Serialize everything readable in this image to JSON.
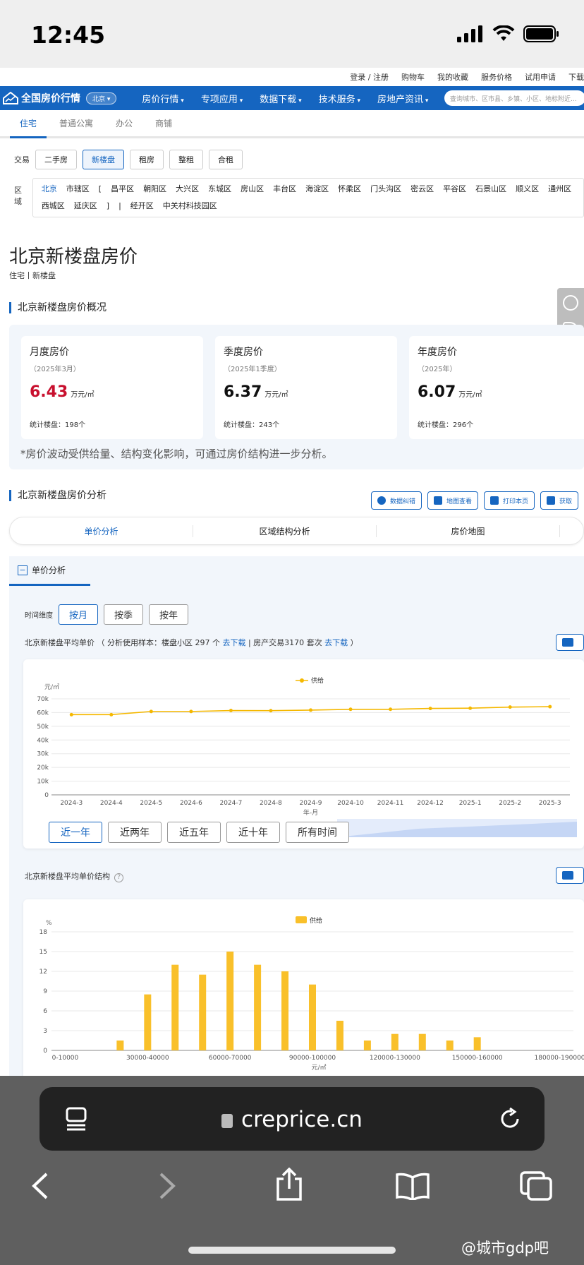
{
  "status_bar": {
    "time": "12:45"
  },
  "topbar": {
    "links": [
      "登录 / 注册",
      "购物车",
      "我的收藏",
      "服务价格",
      "试用申请",
      "下载"
    ]
  },
  "nav": {
    "logo": "全国房价行情",
    "city": "北京",
    "items": [
      "房价行情",
      "专项应用",
      "数据下载",
      "技术服务",
      "房地产资讯"
    ],
    "search_placeholder": "查询城市、区市县、乡镇、小区、地标附近..."
  },
  "property_tabs": [
    "住宅",
    "普通公寓",
    "办公",
    "商铺"
  ],
  "trade": {
    "label": "交易",
    "options": [
      "二手房",
      "新楼盘",
      "租房",
      "整租",
      "合租"
    ]
  },
  "district": {
    "label": "区域",
    "items": [
      "北京",
      "市辖区",
      "[",
      "昌平区",
      "朝阳区",
      "大兴区",
      "东城区",
      "房山区",
      "丰台区",
      "海淀区",
      "怀柔区",
      "门头沟区",
      "密云区",
      "平谷区",
      "石景山区",
      "顺义区",
      "通州区",
      "西城区",
      "延庆区",
      "]",
      "|",
      "经开区",
      "中关村科技园区"
    ]
  },
  "page_title": "北京新楼盘房价",
  "breadcrumb": "住宅丨新楼盘",
  "overview": {
    "heading": "北京新楼盘房价概况",
    "cards": [
      {
        "title": "月度房价",
        "period": "（2025年3月）",
        "value": "6.43",
        "unit": "万元/㎡",
        "count": "统计楼盘：198个"
      },
      {
        "title": "季度房价",
        "period": "（2025年1季度）",
        "value": "6.37",
        "unit": "万元/㎡",
        "count": "统计楼盘：243个"
      },
      {
        "title": "年度房价",
        "period": "（2025年）",
        "value": "6.07",
        "unit": "万元/㎡",
        "count": "统计楼盘：296个"
      }
    ],
    "note": "*房价波动受供给量、结构变化影响，可通过房价结构进一步分析。"
  },
  "analysis": {
    "heading": "北京新楼盘房价分析",
    "tools": [
      "数据纠错",
      "地图查看",
      "打印本页",
      "获取"
    ],
    "tabs": [
      "单价分析",
      "区域结构分析",
      "房价地图"
    ],
    "panel_tab": "单价分析",
    "dimension_label": "时间维度",
    "dimensions": [
      "按月",
      "按季",
      "按年"
    ],
    "caption_pre": "北京新楼盘平均单价 （ 分析使用样本：楼盘小区 297 个 ",
    "caption_link1": "去下载",
    "caption_mid": " | 房产交易3170 套次 ",
    "caption_link2": "去下载",
    "caption_post": " ）",
    "ranges": [
      "近一年",
      "近两年",
      "近五年",
      "近十年",
      "所有时间"
    ],
    "structure_caption": "北京新楼盘平均单价结构"
  },
  "chart_data": [
    {
      "type": "line",
      "title": "",
      "ylabel": "元/㎡",
      "xlabel": "年-月",
      "legend": "top-center",
      "grid": true,
      "ylim": [
        0,
        70000
      ],
      "y_ticks": [
        "0",
        "10k",
        "20k",
        "30k",
        "40k",
        "50k",
        "60k",
        "70k"
      ],
      "categories": [
        "2024-3",
        "2024-4",
        "2024-5",
        "2024-6",
        "2024-7",
        "2024-8",
        "2024-9",
        "2024-10",
        "2024-11",
        "2024-12",
        "2025-1",
        "2025-2",
        "2025-3"
      ],
      "series": [
        {
          "name": "供给",
          "color": "#f5b800",
          "values": [
            58500,
            58500,
            60800,
            60800,
            61500,
            61400,
            61800,
            62400,
            62400,
            63000,
            63200,
            64000,
            64300
          ]
        }
      ]
    },
    {
      "type": "bar",
      "title": "",
      "ylabel": "%",
      "xlabel": "元/㎡",
      "legend": "top-center",
      "grid": true,
      "ylim": [
        0,
        18
      ],
      "y_ticks": [
        "0",
        "3",
        "6",
        "9",
        "12",
        "15",
        "18"
      ],
      "x_labels": [
        "0-10000",
        "30000-40000",
        "60000-70000",
        "90000-100000",
        "120000-130000",
        "150000-160000",
        "180000-190000"
      ],
      "bins": 19,
      "series": [
        {
          "name": "供给",
          "color": "#f9c02a",
          "values": [
            0,
            0,
            1.5,
            8.5,
            13,
            11.5,
            15,
            13,
            12,
            10,
            4.5,
            1.5,
            2.5,
            2.5,
            1.5,
            2,
            0,
            0,
            0
          ]
        }
      ]
    }
  ],
  "browser": {
    "url": "creprice.cn"
  },
  "watermark": "@城市gdp吧"
}
